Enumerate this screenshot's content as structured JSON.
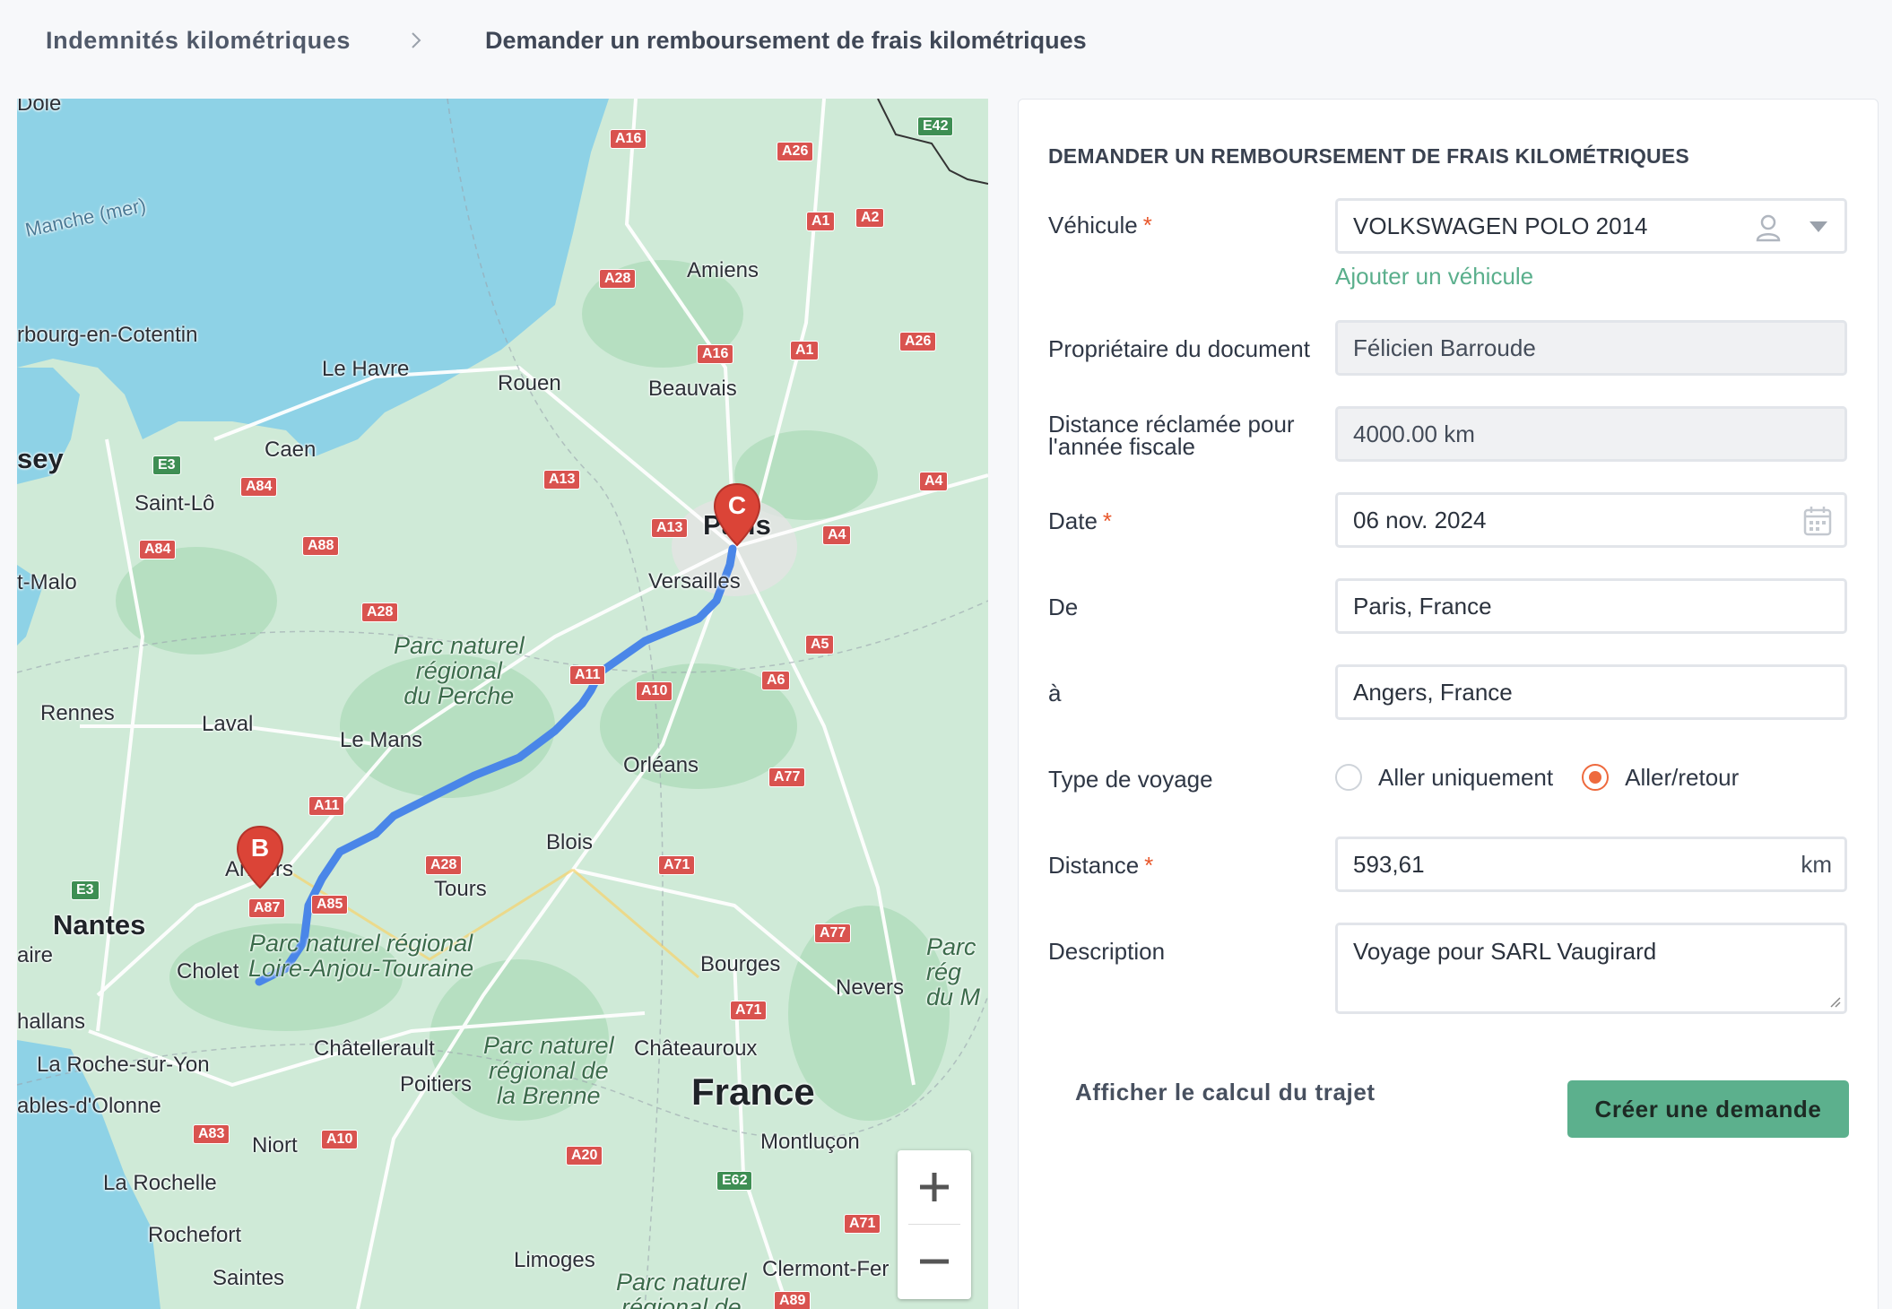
{
  "breadcrumb": {
    "parent": "Indemnités kilométriques",
    "current": "Demander un remboursement de frais kilométriques"
  },
  "map": {
    "labels": {
      "manche": "Manche (mer)",
      "cherbourg": "rbourg-en-Cotentin",
      "lehavre": "Le Havre",
      "rouen": "Rouen",
      "amiens": "Amiens",
      "beauvais": "Beauvais",
      "caen": "Caen",
      "saintlo": "Saint-Lô",
      "jersey": "sey",
      "stmalo": "t-Malo",
      "paris": "Paris",
      "versailles": "Versailles",
      "rennes": "Rennes",
      "laval": "Laval",
      "lemans": "Le Mans",
      "orleans": "Orléans",
      "blois": "Blois",
      "tours": "Tours",
      "angers": "Angers",
      "nantes": "Nantes",
      "cholet": "Cholet",
      "bourges": "Bourges",
      "nevers": "Nevers",
      "chatellerault": "Châtellerault",
      "chateauroux": "Châteauroux",
      "poitiers": "Poitiers",
      "france": "France",
      "larochesuryon": "La Roche-sur-Yon",
      "sables": "ables-d'Olonne",
      "niort": "Niort",
      "larochelle": "La Rochelle",
      "montlucon": "Montluçon",
      "rochefort": "Rochefort",
      "limoges": "Limoges",
      "clermont": "Clermont-Fer",
      "saintes": "Saintes",
      "challans": "hallans",
      "aire": "aire",
      "pole": "Dole",
      "park_perche": "Parc naturel\nrégional\ndu Perche",
      "park_loire": "Parc naturel régional\nLoire-Anjou-Touraine",
      "park_brenne": "Parc naturel\nrégional de\nla Brenne",
      "park_morvan": "Parc\nrég\ndu M",
      "park_limousin": "Parc naturel\nrégional de"
    },
    "markers": {
      "start": "C",
      "end": "B"
    },
    "roads": [
      "A16",
      "A26",
      "E42",
      "A1",
      "A2",
      "A28",
      "A16",
      "A1",
      "A26",
      "E3",
      "A84",
      "A13",
      "A4",
      "A84",
      "A88",
      "A13",
      "A4",
      "A28",
      "A11",
      "A10",
      "A6",
      "A5",
      "A77",
      "A11",
      "A28",
      "A71",
      "E3",
      "A87",
      "A85",
      "A77",
      "A71",
      "A83",
      "A10",
      "A20",
      "E62",
      "A71",
      "A89"
    ],
    "zoom_in": "+",
    "zoom_out": "−"
  },
  "form": {
    "title": "DEMANDER UN REMBOURSEMENT DE FRAIS KILOMÉTRIQUES",
    "vehicle": {
      "label": "Véhicule",
      "value": "VOLKSWAGEN POLO 2014",
      "add_link": "Ajouter un véhicule"
    },
    "owner": {
      "label": "Propriétaire du document",
      "value": "Félicien Barroude"
    },
    "claimed": {
      "label_line1": "Distance réclamée pour",
      "label_line2": "l'année fiscale",
      "value": "4000.00 km"
    },
    "date": {
      "label": "Date",
      "value": "06 nov. 2024"
    },
    "from": {
      "label": "De",
      "value": "Paris, France"
    },
    "to": {
      "label": "à",
      "value": "Angers, France"
    },
    "trip_type": {
      "label": "Type de voyage",
      "option_one_way": "Aller uniquement",
      "option_round": "Aller/retour",
      "selected": "Aller/retour"
    },
    "distance": {
      "label": "Distance",
      "value": "593,61",
      "unit": "km"
    },
    "description": {
      "label": "Description",
      "value": "Voyage pour SARL Vaugirard"
    },
    "required_mark": "*",
    "show_route": "Afficher le calcul du trajet",
    "submit": "Créer une demande"
  },
  "colors": {
    "accent": "#5cb08d",
    "required": "#e8572b",
    "radio": "#ee6a3e",
    "route": "#4a86e8",
    "marker": "#db4437"
  }
}
